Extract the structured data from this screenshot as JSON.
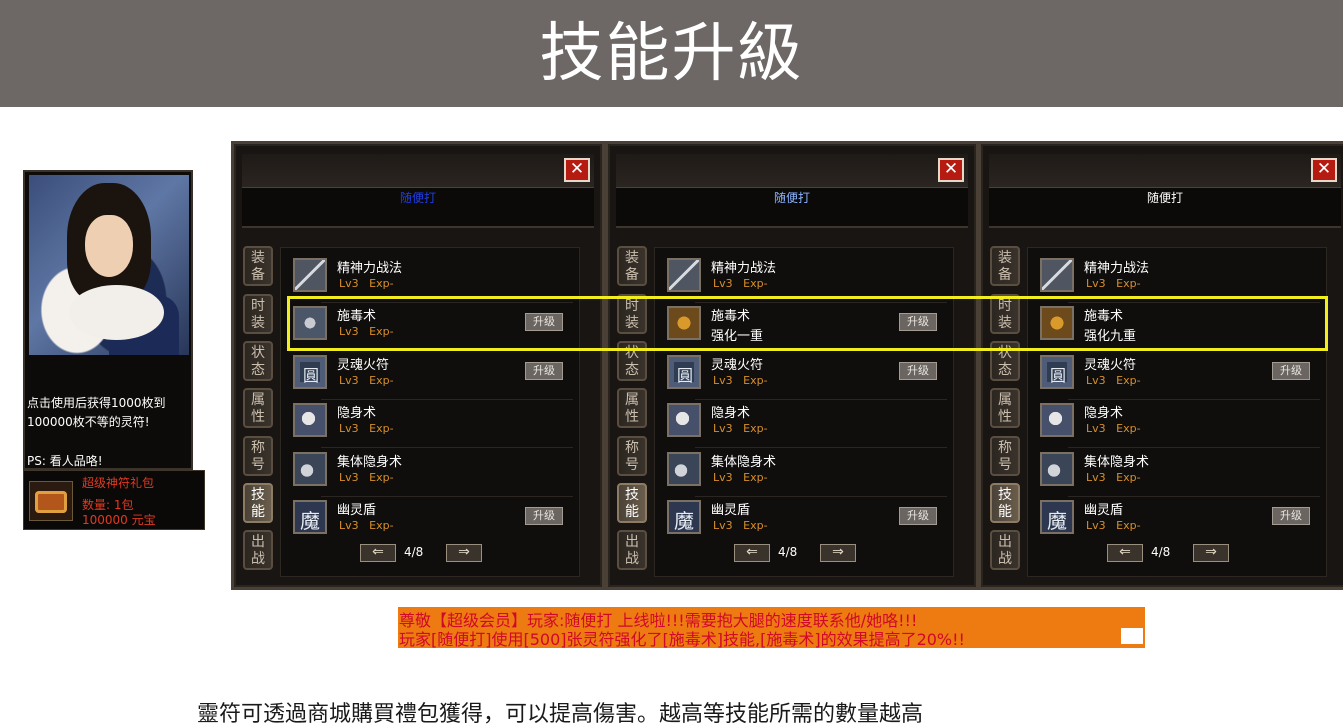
{
  "header": {
    "title": "技能升級"
  },
  "item_tooltip": {
    "description": "点击使用后获得1000枚到100000枚不等的灵符!",
    "ps": "PS: 看人品咯!",
    "item_name": "超级神符礼包",
    "quantity": "数量: 1包",
    "price": "100000 元宝"
  },
  "side_tabs": [
    "装备",
    "时装",
    "状态",
    "属性",
    "称号",
    "技能",
    "出战"
  ],
  "panels": [
    {
      "player_name": "随便打",
      "player_name_color": "#1f3ee6",
      "close_label": "✕",
      "skills": [
        {
          "name": "精神力战法",
          "level": "Lv3",
          "exp": "Exp-",
          "upgrade": "",
          "icon": "blade-icon"
        },
        {
          "name": "施毒术",
          "level": "Lv3",
          "exp": "Exp-",
          "upgrade": "升级",
          "icon": "poison-icon"
        },
        {
          "name": "灵魂火符",
          "level": "Lv3",
          "exp": "Exp-",
          "upgrade": "升级",
          "icon": "talisman-icon"
        },
        {
          "name": "隐身术",
          "level": "Lv3",
          "exp": "Exp-",
          "upgrade": "",
          "icon": "stealth-icon"
        },
        {
          "name": "集体隐身术",
          "level": "Lv3",
          "exp": "Exp-",
          "upgrade": "",
          "icon": "group-stealth-icon"
        },
        {
          "name": "幽灵盾",
          "level": "Lv3",
          "exp": "Exp-",
          "upgrade": "升级",
          "icon": "ghost-shield-icon"
        }
      ],
      "page": "4/8"
    },
    {
      "player_name": "随便打",
      "player_name_color": "#8ab4ff",
      "close_label": "✕",
      "skills": [
        {
          "name": "精神力战法",
          "level": "Lv3",
          "exp": "Exp-",
          "upgrade": "",
          "icon": "blade-icon"
        },
        {
          "name": "施毒术",
          "sub": "强化一重",
          "upgrade": "升级",
          "icon": "poison-icon"
        },
        {
          "name": "灵魂火符",
          "level": "Lv3",
          "exp": "Exp-",
          "upgrade": "升级",
          "icon": "talisman-icon"
        },
        {
          "name": "隐身术",
          "level": "Lv3",
          "exp": "Exp-",
          "upgrade": "",
          "icon": "stealth-icon"
        },
        {
          "name": "集体隐身术",
          "level": "Lv3",
          "exp": "Exp-",
          "upgrade": "",
          "icon": "group-stealth-icon"
        },
        {
          "name": "幽灵盾",
          "level": "Lv3",
          "exp": "Exp-",
          "upgrade": "升级",
          "icon": "ghost-shield-icon"
        }
      ],
      "page": "4/8"
    },
    {
      "player_name": "随便打",
      "player_name_color": "#ffffff",
      "close_label": "✕",
      "skills": [
        {
          "name": "精神力战法",
          "level": "Lv3",
          "exp": "Exp-",
          "upgrade": "",
          "icon": "blade-icon"
        },
        {
          "name": "施毒术",
          "sub": "强化九重",
          "upgrade": "",
          "icon": "poison-icon"
        },
        {
          "name": "灵魂火符",
          "level": "Lv3",
          "exp": "Exp-",
          "upgrade": "升级",
          "icon": "talisman-icon"
        },
        {
          "name": "隐身术",
          "level": "Lv3",
          "exp": "Exp-",
          "upgrade": "",
          "icon": "stealth-icon"
        },
        {
          "name": "集体隐身术",
          "level": "Lv3",
          "exp": "Exp-",
          "upgrade": "",
          "icon": "group-stealth-icon"
        },
        {
          "name": "幽灵盾",
          "level": "Lv3",
          "exp": "Exp-",
          "upgrade": "升级",
          "icon": "ghost-shield-icon"
        }
      ],
      "page": "4/8"
    }
  ],
  "pager": {
    "prev_label": "⇐",
    "next_label": "⇒"
  },
  "broadcast": {
    "line1": "尊敬【超级会员】玩家:随便打 上线啦!!!需要抱大腿的速度联系他/她咯!!!",
    "line2": "玩家[随便打]使用[500]张灵符强化了[施毒术]技能,[施毒术]的效果提高了20%!!",
    "bg_color": "#ee7a12",
    "text_color": "#d0082a"
  },
  "caption": "靈符可透過商城購買禮包獲得，可以提高傷害。越高等技能所需的數量越高",
  "colors": {
    "banner": "#6d6766",
    "highlight": "#f2ee1d",
    "close": "#b61b12"
  }
}
